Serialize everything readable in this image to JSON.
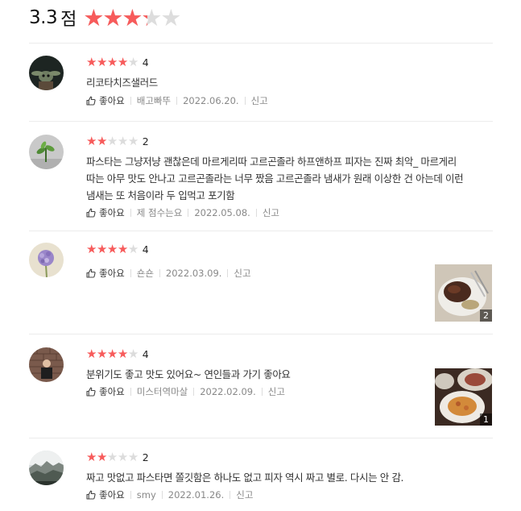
{
  "summary": {
    "score": "3.3",
    "unit": "점",
    "rating_fraction": 0.66,
    "star_color": "#f75b5b",
    "star_empty_color": "#dddddd"
  },
  "like_icon": "thumbs-up-icon",
  "reviews": [
    {
      "rating": 4,
      "rating_label": "4",
      "text_lines": [
        "리코타치즈샐러드"
      ],
      "like_label": "좋아요",
      "author": "배고빠뚜",
      "date": "2022.06.20.",
      "report_label": "신고",
      "avatar": "baby-yoda-avatar"
    },
    {
      "rating": 2,
      "rating_label": "2",
      "text_lines": [
        "파스타는 그냥저냥 괜찮은데 마르게리따 고르곤졸라 하프앤하프 피자는 진짜 최악_ 마르게리",
        "따는 아무 맛도 안나고 고르곤졸라는 너무 짰음 고르곤졸라 냄새가 원래 이상한 건 아는데 이런",
        "냄새는 또 처음이라 두 입먹고 포기함"
      ],
      "like_label": "좋아요",
      "author": "제 점수는요",
      "date": "2022.05.08.",
      "report_label": "신고",
      "avatar": "plant-avatar"
    },
    {
      "rating": 4,
      "rating_label": "4",
      "text_lines": [],
      "like_label": "좋아요",
      "author": "숀숀",
      "date": "2022.03.09.",
      "report_label": "신고",
      "avatar": "hydrangea-avatar",
      "photo_count": "2",
      "photo": "steak-plate-photo"
    },
    {
      "rating": 4,
      "rating_label": "4",
      "text_lines": [
        "분위기도 좋고 맛도 있어요~ 연인들과 가기 좋아요"
      ],
      "like_label": "좋아요",
      "author": "미스터역마살",
      "date": "2022.02.09.",
      "report_label": "신고",
      "avatar": "person-brick-wall-avatar",
      "photo_count": "1",
      "photo": "pasta-dishes-photo"
    },
    {
      "rating": 2,
      "rating_label": "2",
      "text_lines": [
        "짜고 맛없고 파스타면 쫄깃함은 하나도 없고 피자 역시 짜고 별로. 다시는 안 감."
      ],
      "like_label": "좋아요",
      "author": "smy",
      "date": "2022.01.26.",
      "report_label": "신고",
      "avatar": "misty-forest-avatar"
    }
  ]
}
